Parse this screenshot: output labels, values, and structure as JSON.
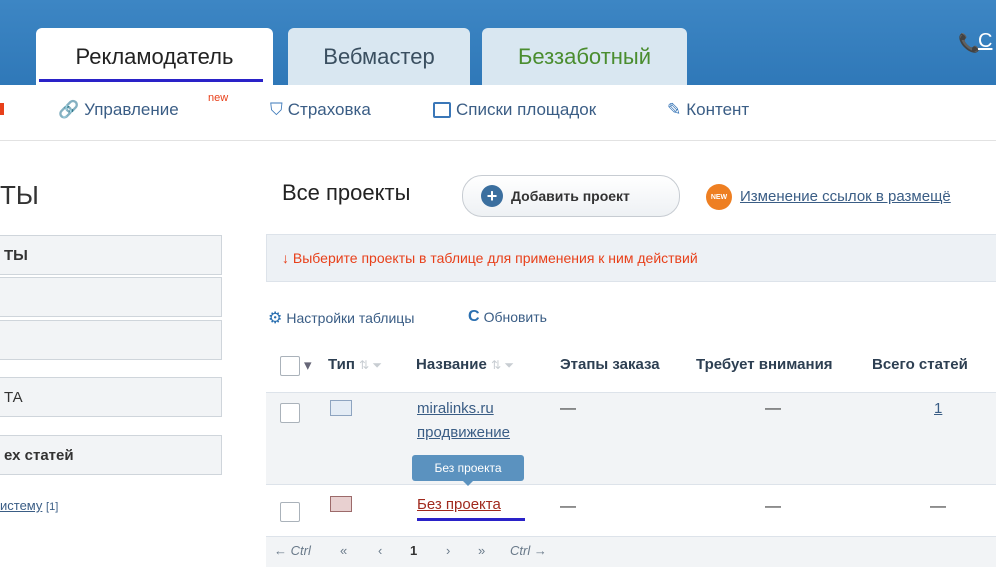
{
  "header": {
    "tabs": [
      {
        "label": "Рекламодатель",
        "active": true
      },
      {
        "label": "Вебмастер",
        "active": false
      },
      {
        "label": "Беззаботный",
        "active": false
      }
    ],
    "phone_fragment": "С"
  },
  "subnav": {
    "items": [
      {
        "label": "Управление",
        "badge": "new",
        "icon": "link-icon"
      },
      {
        "label": "Страховка",
        "icon": "shield-icon"
      },
      {
        "label": "Списки площадок",
        "icon": "list-icon"
      },
      {
        "label": "Контент",
        "icon": "edit-icon"
      }
    ]
  },
  "sidebar": {
    "title_fragment": "ТЫ",
    "boxes": [
      "ТЫ",
      "",
      "",
      "ТА",
      "ех статей"
    ],
    "link_fragment": "истему",
    "link_count": "[1]"
  },
  "main": {
    "title": "Все проекты",
    "add_button": "Добавить проект",
    "new_badge": "NEW",
    "news_link": "Изменение ссылок в размещё",
    "notice": "↓ Выберите проекты в таблице для применения к ним действий",
    "tools": {
      "settings": "Настройки таблицы",
      "refresh": "Обновить"
    },
    "table": {
      "columns": [
        "Тип",
        "Название",
        "Этапы заказа",
        "Требует внимания",
        "Всего статей"
      ],
      "rows": [
        {
          "name_line1": "miralinks.ru",
          "name_line2": "продвижение",
          "stages": "—",
          "attention": "—",
          "total": "1"
        },
        {
          "name": "Без проекта",
          "stages": "—",
          "attention": "—",
          "total": "—"
        }
      ],
      "tooltip": "Без проекта"
    },
    "pager": {
      "prev_ctrl": "← Ctrl",
      "first": "«",
      "prev": "‹",
      "page": "1",
      "next": "›",
      "last": "»",
      "next_ctrl": "Ctrl →"
    }
  },
  "colors": {
    "header_blue": "#3d86c4",
    "link_blue": "#3a5d85",
    "notice_red": "#e8401a",
    "green_tab": "#4a8d2f"
  }
}
